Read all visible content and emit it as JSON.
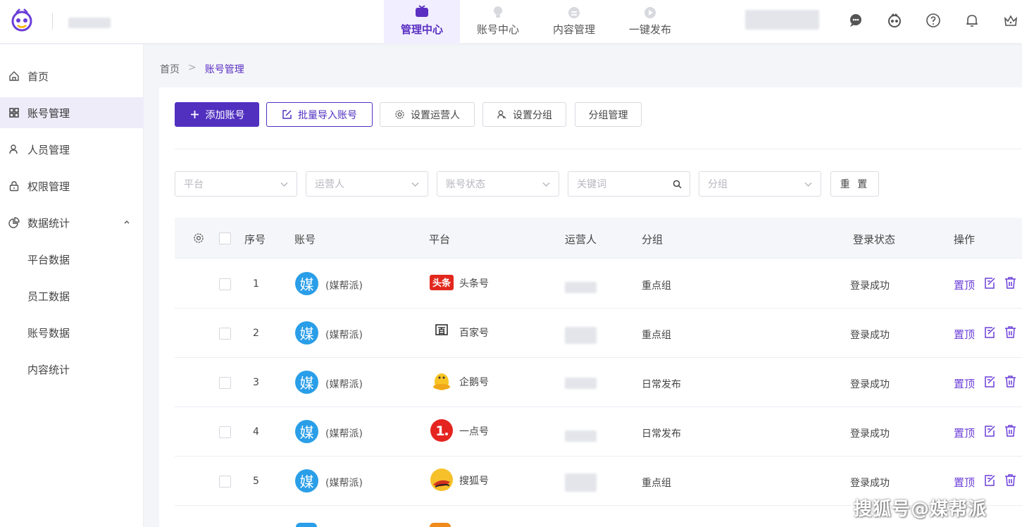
{
  "topnav": {
    "items": [
      {
        "label": "管理中心",
        "icon": "tv-icon"
      },
      {
        "label": "账号中心",
        "icon": "bulb-icon"
      },
      {
        "label": "内容管理",
        "icon": "content-icon"
      },
      {
        "label": "一键发布",
        "icon": "publish-icon"
      }
    ],
    "active_index": 0
  },
  "sidebar": {
    "items": [
      {
        "label": "首页",
        "icon": "home-icon"
      },
      {
        "label": "账号管理",
        "icon": "grid-icon"
      },
      {
        "label": "人员管理",
        "icon": "user-icon"
      },
      {
        "label": "权限管理",
        "icon": "lock-icon"
      },
      {
        "label": "数据统计",
        "icon": "pie-icon"
      }
    ],
    "subitems": [
      "平台数据",
      "员工数据",
      "账号数据",
      "内容统计"
    ]
  },
  "breadcrumb": {
    "home": "首页",
    "sep": ">",
    "current": "账号管理"
  },
  "toolbar": {
    "add": "添加账号",
    "import": "批量导入账号",
    "set_operator": "设置运营人",
    "set_group": "设置分组",
    "group_manage": "分组管理"
  },
  "filters": {
    "platform": "平台",
    "operator": "运营人",
    "status": "账号状态",
    "keyword": "关键词",
    "group": "分组",
    "reset": "重 置"
  },
  "table": {
    "headers": {
      "index": "序号",
      "account": "账号",
      "platform": "平台",
      "operator": "运营人",
      "group": "分组",
      "status": "登录状态",
      "actions": "操作"
    },
    "rows": [
      {
        "index": "1",
        "avatar": "媒",
        "account": "(媒帮派)",
        "platform": "头条号",
        "group": "重点组",
        "status": "登录成功",
        "action": "置顶"
      },
      {
        "index": "2",
        "avatar": "媒",
        "account": "(媒帮派)",
        "platform": "百家号",
        "group": "重点组",
        "status": "登录成功",
        "action": "置顶"
      },
      {
        "index": "3",
        "avatar": "媒",
        "account": "(媒帮派)",
        "platform": "企鹅号",
        "group": "日常发布",
        "status": "登录成功",
        "action": "置顶"
      },
      {
        "index": "4",
        "avatar": "媒",
        "account": "(媒帮派)",
        "platform": "一点号",
        "group": "日常发布",
        "status": "登录成功",
        "action": "置顶"
      },
      {
        "index": "5",
        "avatar": "媒",
        "account": "(媒帮派)",
        "platform": "搜狐号",
        "group": "重点组",
        "status": "登录成功",
        "action": "置顶"
      }
    ]
  },
  "watermark": "搜狐号@媒帮派",
  "colors": {
    "accent": "#5130c0",
    "action": "#6a3ed8",
    "avatar": "#2a9ee8"
  }
}
